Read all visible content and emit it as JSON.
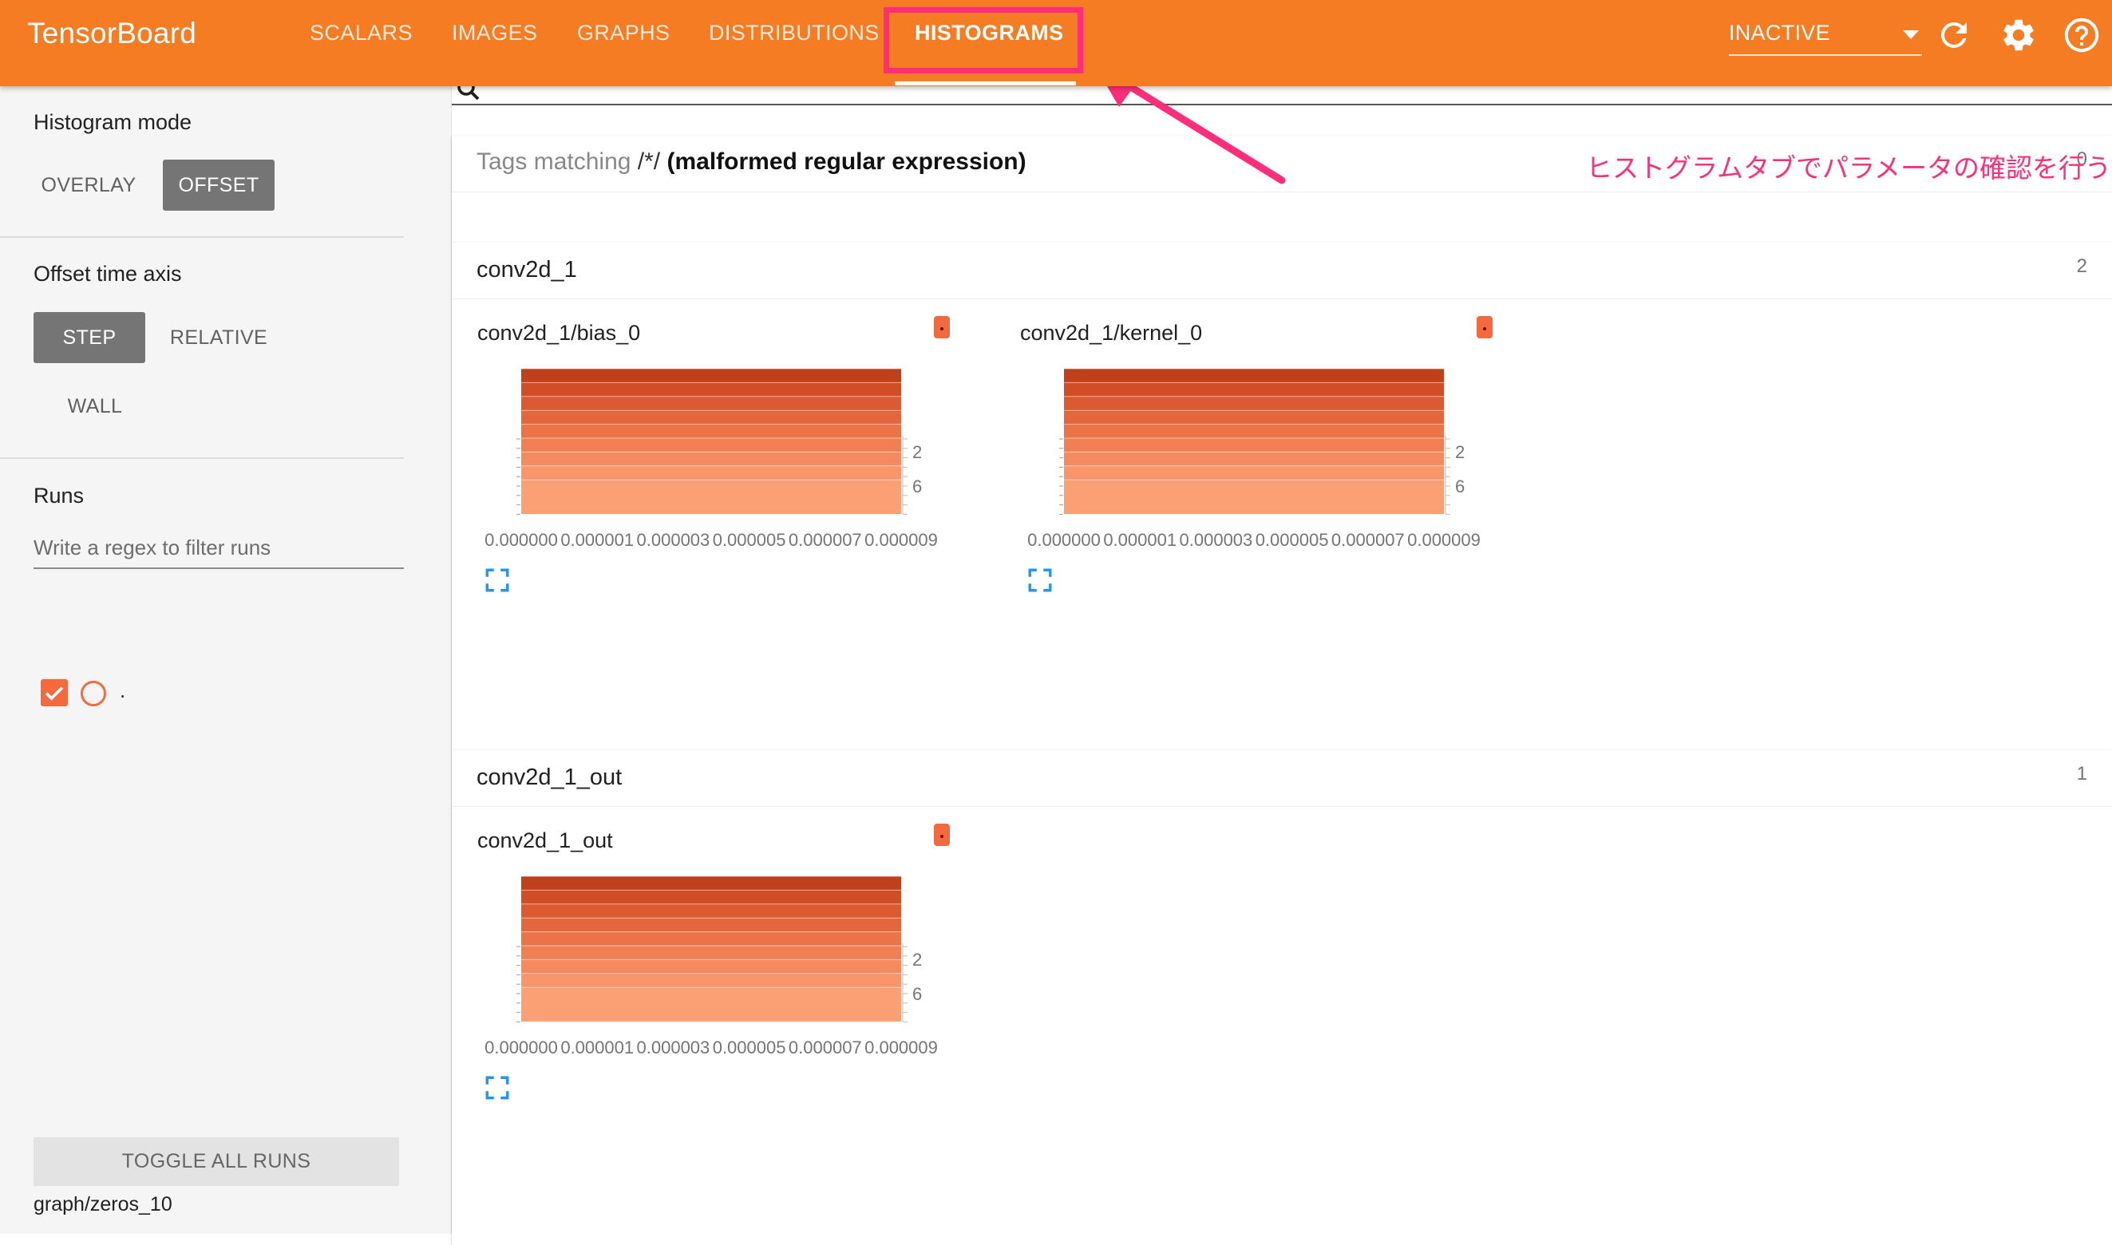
{
  "app": {
    "title": "TensorBoard"
  },
  "tabs": [
    {
      "label": "SCALARS",
      "active": false
    },
    {
      "label": "IMAGES",
      "active": false
    },
    {
      "label": "GRAPHS",
      "active": false
    },
    {
      "label": "DISTRIBUTIONS",
      "active": false
    },
    {
      "label": "HISTOGRAMS",
      "active": true
    }
  ],
  "header": {
    "run_select_value": "INACTIVE",
    "icons": [
      "refresh-icon",
      "settings-gear-icon",
      "help-icon"
    ]
  },
  "sidebar": {
    "histogram_mode": {
      "title": "Histogram mode",
      "options": [
        "OVERLAY",
        "OFFSET"
      ],
      "selected": "OFFSET"
    },
    "offset_time_axis": {
      "title": "Offset time axis",
      "options": [
        "STEP",
        "RELATIVE",
        "WALL"
      ],
      "selected": "STEP"
    },
    "runs": {
      "title": "Runs",
      "filter_placeholder": "Write a regex to filter runs",
      "items": [
        {
          "label": ".",
          "checked": true
        }
      ]
    },
    "toggle_all_label": "TOGGLE ALL RUNS",
    "footer_text": "graph/zeros_10"
  },
  "tags_card": {
    "label": "Tags matching ",
    "pattern": "/*/",
    "error": " (malformed regular expression)",
    "count": "0"
  },
  "annotation": "ヒストグラムタブでパラメータの確認を行う",
  "groups": [
    {
      "title": "conv2d_1",
      "count": "2",
      "charts": [
        {
          "title": "conv2d_1/bias_0"
        },
        {
          "title": "conv2d_1/kernel_0"
        }
      ]
    },
    {
      "title": "conv2d_1_out",
      "count": "1",
      "charts": [
        {
          "title": "conv2d_1_out"
        }
      ]
    }
  ],
  "chart_data": {
    "type": "area",
    "mode": "offset",
    "y_tick_labels": [
      "2",
      "6"
    ],
    "x_tick_labels": [
      "0.000000",
      "0.000001",
      "0.000003",
      "0.000005",
      "0.000007",
      "0.000009"
    ],
    "band_colors": [
      "#c1401c",
      "#d04d26",
      "#db5a31",
      "#e5663c",
      "#ec7247",
      "#f27e53",
      "#f68a5f",
      "#f9956b",
      "#fb9f75"
    ]
  }
}
